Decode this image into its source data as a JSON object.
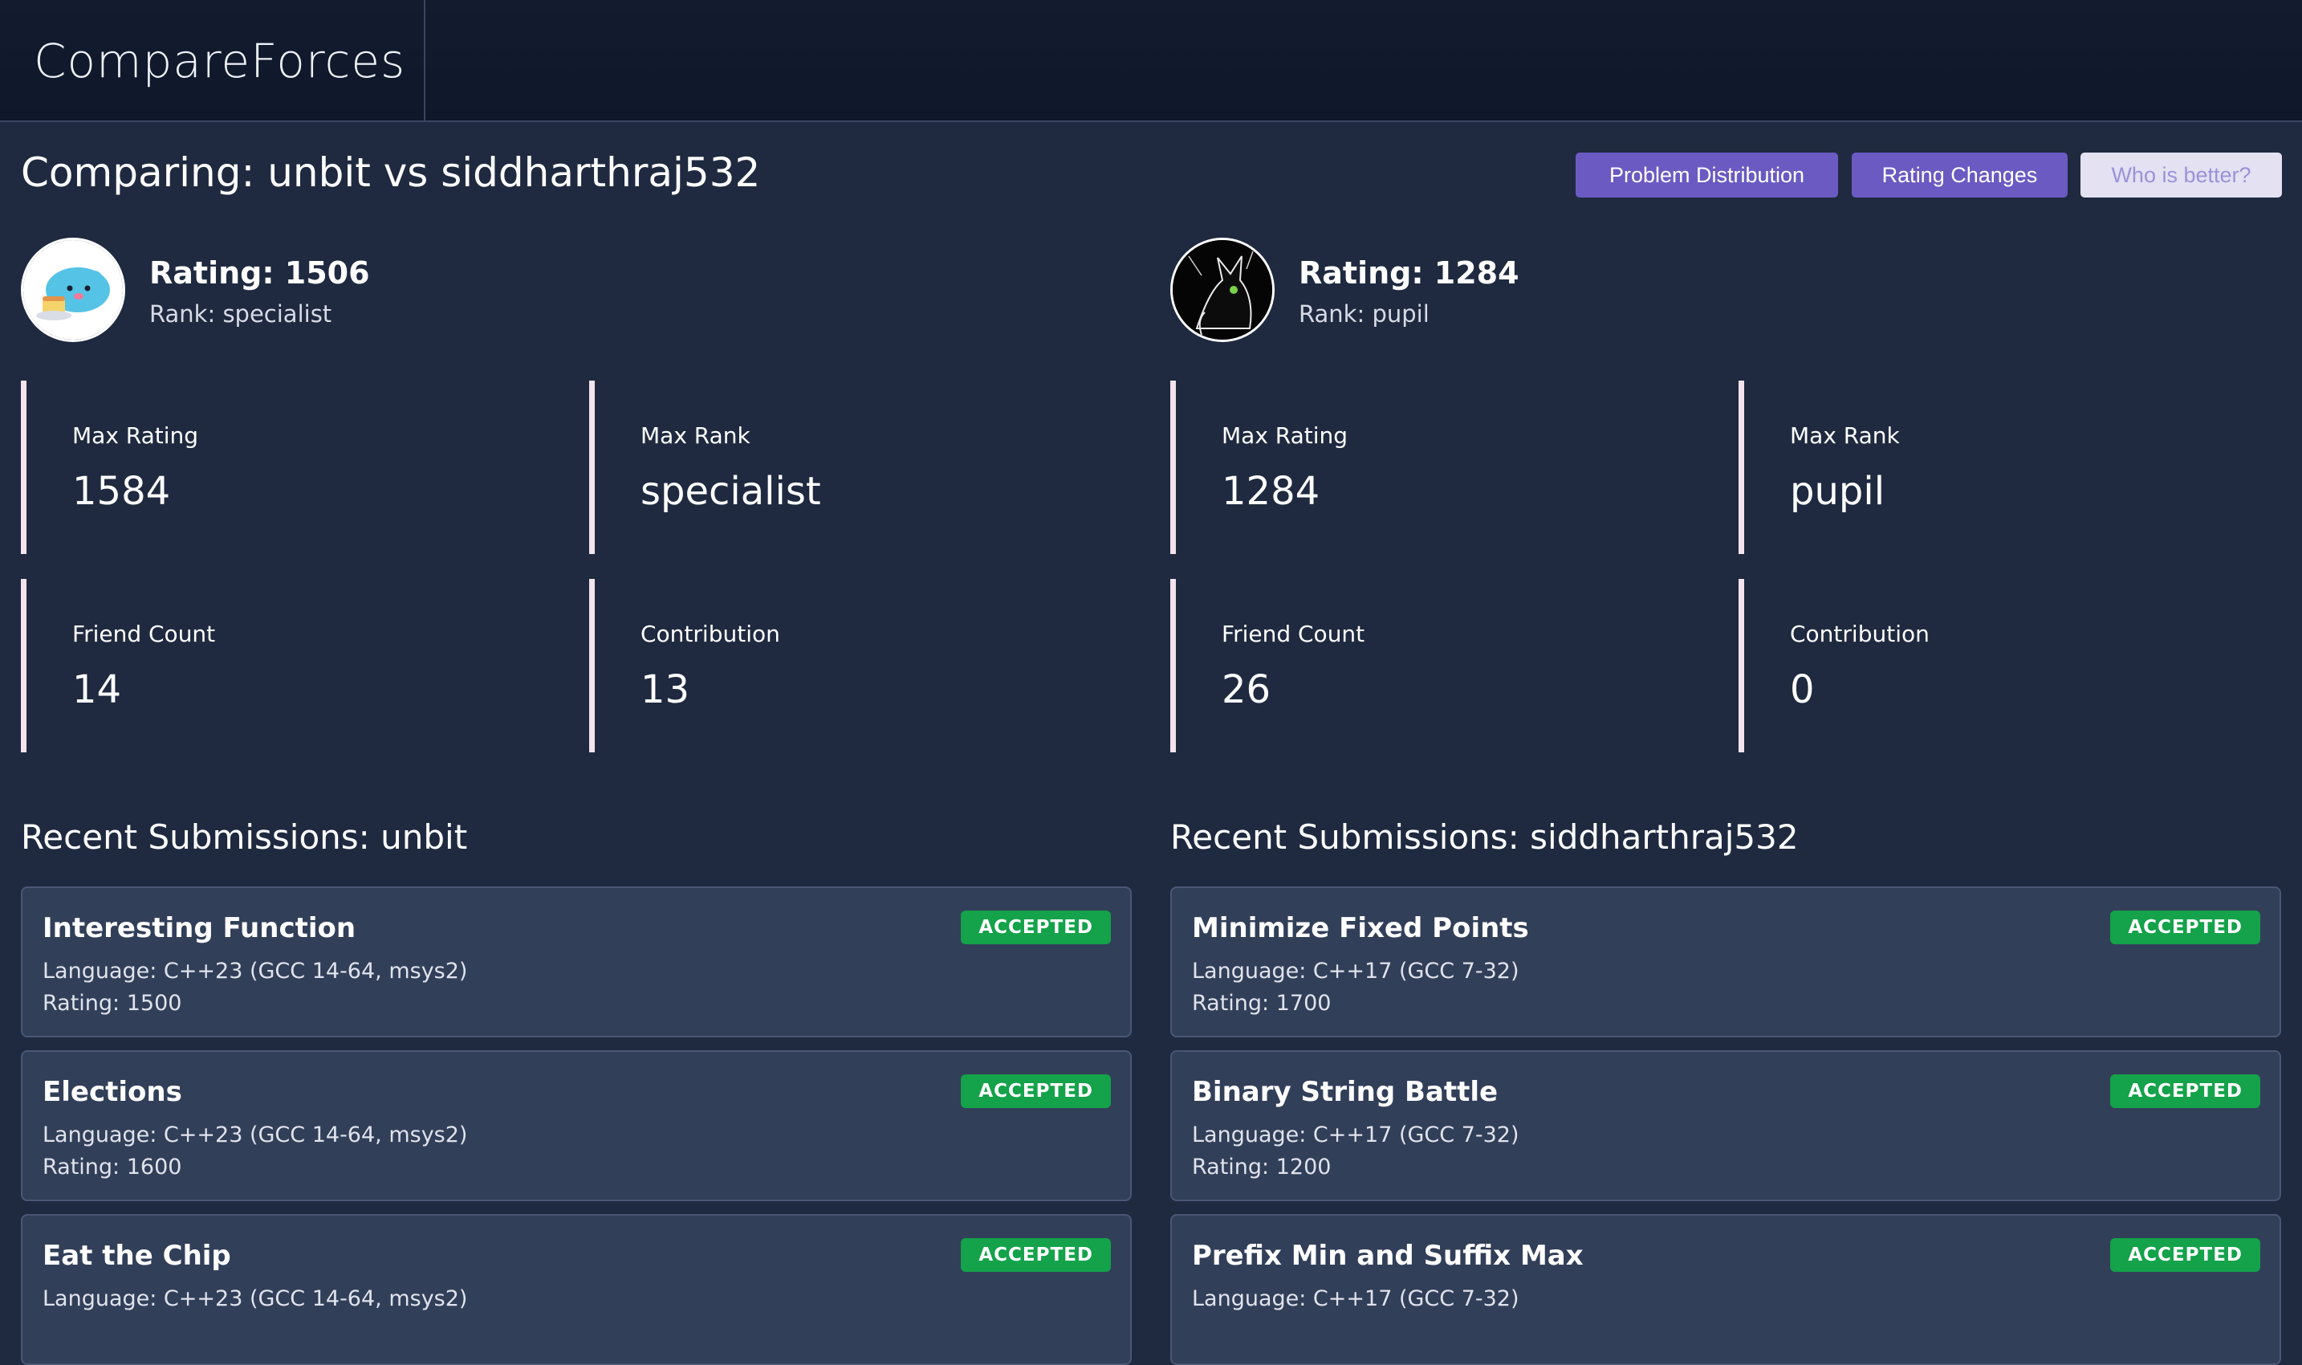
{
  "app": {
    "title": "CompareForces"
  },
  "page": {
    "title": "Comparing: unbit vs siddharthraj532"
  },
  "buttons": {
    "problem_distribution": "Problem Distribution",
    "rating_changes": "Rating Changes",
    "who_is_better": "Who is better?"
  },
  "users": [
    {
      "handle": "unbit",
      "rating": "Rating: 1506",
      "rank": "Rank: specialist",
      "avatar_icon": "capybara-cartoon-avatar",
      "stats": {
        "max_rating_label": "Max Rating",
        "max_rating": "1584",
        "max_rank_label": "Max Rank",
        "max_rank": "specialist",
        "friend_count_label": "Friend Count",
        "friend_count": "14",
        "contribution_label": "Contribution",
        "contribution": "13"
      },
      "subs_title": "Recent Submissions: unbit",
      "submissions": [
        {
          "name": "Interesting Function",
          "verdict": "ACCEPTED",
          "language": "Language: C++23 (GCC 14-64, msys2)",
          "rating": "Rating: 1500"
        },
        {
          "name": "Elections",
          "verdict": "ACCEPTED",
          "language": "Language: C++23 (GCC 14-64, msys2)",
          "rating": "Rating: 1600"
        },
        {
          "name": "Eat the Chip",
          "verdict": "ACCEPTED",
          "language": "Language: C++23 (GCC 14-64, msys2)",
          "rating": ""
        }
      ]
    },
    {
      "handle": "siddharthraj532",
      "rating": "Rating: 1284",
      "rank": "Rank: pupil",
      "avatar_icon": "black-cat-avatar",
      "stats": {
        "max_rating_label": "Max Rating",
        "max_rating": "1284",
        "max_rank_label": "Max Rank",
        "max_rank": "pupil",
        "friend_count_label": "Friend Count",
        "friend_count": "26",
        "contribution_label": "Contribution",
        "contribution": "0"
      },
      "subs_title": "Recent Submissions: siddharthraj532",
      "submissions": [
        {
          "name": "Minimize Fixed Points",
          "verdict": "ACCEPTED",
          "language": "Language: C++17 (GCC 7-32)",
          "rating": "Rating: 1700"
        },
        {
          "name": "Binary String Battle",
          "verdict": "ACCEPTED",
          "language": "Language: C++17 (GCC 7-32)",
          "rating": "Rating: 1200"
        },
        {
          "name": "Prefix Min and Suffix Max",
          "verdict": "ACCEPTED",
          "language": "Language: C++17 (GCC 7-32)",
          "rating": ""
        }
      ]
    }
  ],
  "colors": {
    "background": "#1f2a40",
    "topbar": "#0f172a",
    "accent": "#6a5ac2",
    "card": "#323f59",
    "accepted": "#14a24a",
    "stat_border": "#f2e3ec"
  }
}
